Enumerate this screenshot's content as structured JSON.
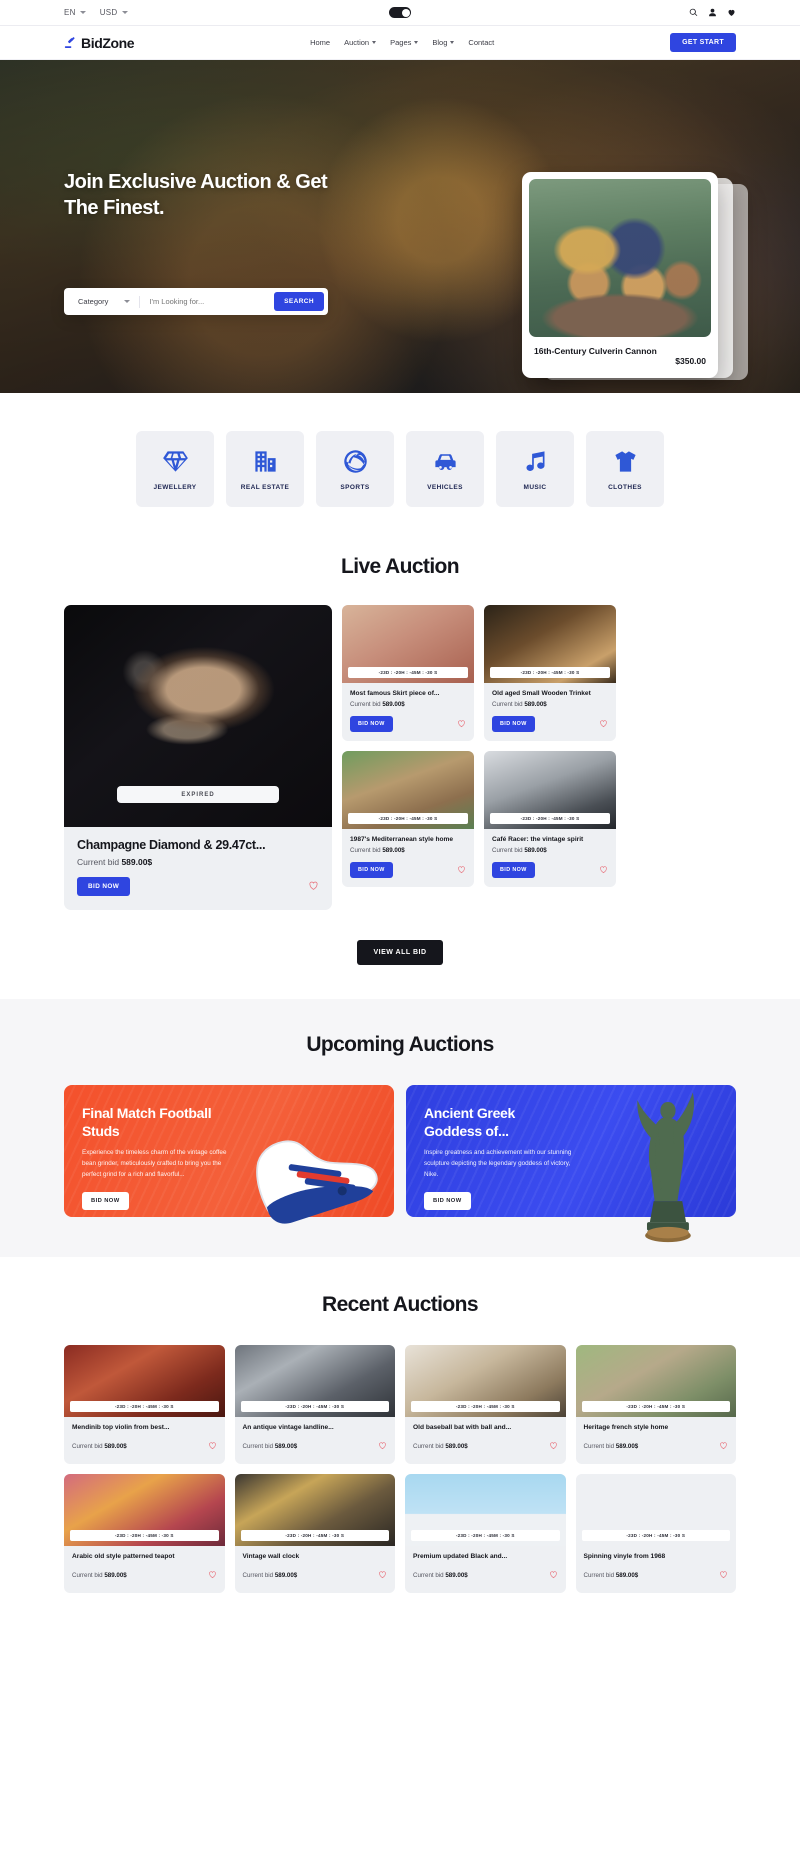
{
  "topbar": {
    "language": "EN",
    "currency": "USD",
    "icons": [
      "search-icon",
      "user-icon",
      "heart-icon"
    ],
    "mode_toggle": "dark-mode-toggle"
  },
  "header": {
    "brand": "BidZone",
    "nav": [
      {
        "label": "Home",
        "caret": false
      },
      {
        "label": "Auction",
        "caret": true
      },
      {
        "label": "Pages",
        "caret": true
      },
      {
        "label": "Blog",
        "caret": true
      },
      {
        "label": "Contact",
        "caret": false
      }
    ],
    "cta": "GET START",
    "accent": "#2f45e0"
  },
  "hero": {
    "title": "Join Exclusive Auction & Get The Finest.",
    "category_label": "Category",
    "search_placeholder": "I'm Looking for...",
    "search_value": "",
    "search_button": "SEARCH",
    "card": {
      "name": "16th-Century Culverin Cannon",
      "price": "$350.00"
    }
  },
  "categories": [
    {
      "label": "JEWELLERY",
      "icon": "diamond-icon"
    },
    {
      "label": "REAL ESTATE",
      "icon": "building-icon"
    },
    {
      "label": "SPORTS",
      "icon": "volleyball-icon"
    },
    {
      "label": "VEHICLES",
      "icon": "car-icon"
    },
    {
      "label": "MUSIC",
      "icon": "music-note-icon"
    },
    {
      "label": "CLOTHES",
      "icon": "tshirt-icon"
    }
  ],
  "live_auction": {
    "title": "Live Auction",
    "view_all": "VIEW ALL BID",
    "bid_label": "BID NOW",
    "bid_prefix": "Current bid",
    "featured": {
      "name": "Champagne Diamond & 29.47ct...",
      "bid_prefix": "Current bid",
      "bid": "589.00$",
      "status": "EXPIRED",
      "button": "BID NOW"
    },
    "items": [
      {
        "name": "Most famous Skirt piece of...",
        "bid": "589.00$",
        "timer": "-23D  :  -20H  :  -45M  :  -30 S"
      },
      {
        "name": "Old aged Small Wooden Trinket",
        "bid": "589.00$",
        "timer": "-23D  :  -20H  :  -45M  :  -30 S"
      },
      {
        "name": "1987's Mediterranean style home",
        "bid": "589.00$",
        "timer": "-23D  :  -20H  :  -45M  :  -30 S"
      },
      {
        "name": "Café Racer: the vintage spirit",
        "bid": "589.00$",
        "timer": "-23D  :  -20H  :  -45M  :  -30 S"
      }
    ]
  },
  "upcoming": {
    "title": "Upcoming Auctions",
    "cards": [
      {
        "title": "Final Match Football Studs",
        "desc": "Experience the timeless charm of the vintage coffee bean grinder, meticulously crafted to bring you the perfect grind for a rich and flavorful...",
        "button": "BID NOW",
        "color": "#f4512c"
      },
      {
        "title": "Ancient Greek Goddess of...",
        "desc": "Inspire greatness and achievement with our stunning sculpture depicting the legendary goddess of victory, Nike.",
        "button": "BID NOW",
        "color": "#2f3fe0"
      }
    ]
  },
  "recent": {
    "title": "Recent Auctions",
    "bid_prefix": "Current bid",
    "items": [
      {
        "name": "Mendinib top violin from best...",
        "bid": "589.00$",
        "timer": "-23D  :  -20H  :  -45M  :  -30 S"
      },
      {
        "name": "An antique vintage landline...",
        "bid": "589.00$",
        "timer": "-23D  :  -20H  :  -45M  :  -30 S"
      },
      {
        "name": "Old baseball bat with ball and...",
        "bid": "589.00$",
        "timer": "-23D  :  -20H  :  -45M  :  -30 S"
      },
      {
        "name": "Heritage french style home",
        "bid": "589.00$",
        "timer": "-23D  :  -20H  :  -45M  :  -30 S"
      },
      {
        "name": "Arabic old style patterned teapot",
        "bid": "589.00$",
        "timer": "-23D  :  -20H  :  -45M  :  -30 S"
      },
      {
        "name": "Vintage wall clock",
        "bid": "589.00$",
        "timer": "-23D  :  -20H  :  -45M  :  -30 S"
      },
      {
        "name": "Premium updated Black and...",
        "bid": "589.00$",
        "timer": "-23D  :  -20H  :  -45M  :  -30 S"
      },
      {
        "name": "Spinning vinyle from 1968",
        "bid": "589.00$",
        "timer": "-23D  :  -20H  :  -45M  :  -30 S"
      }
    ]
  }
}
